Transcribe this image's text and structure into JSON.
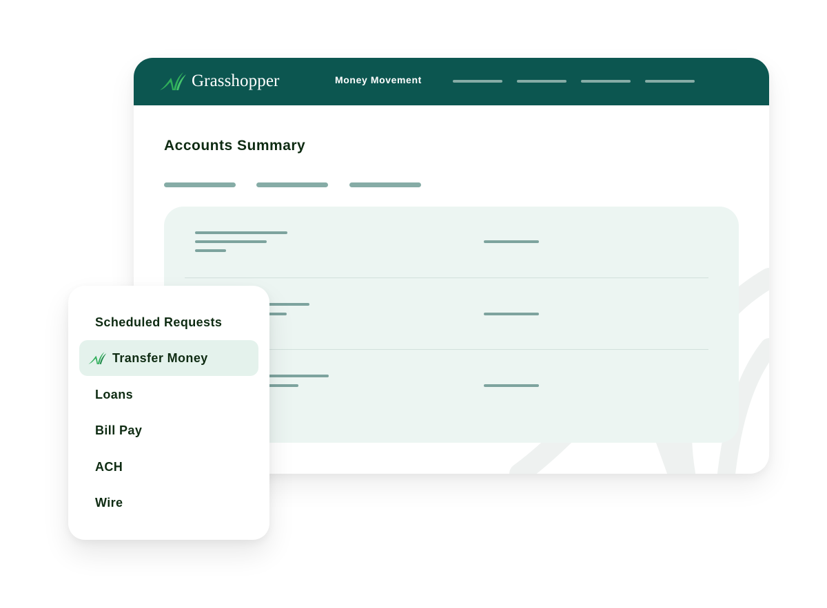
{
  "app": {
    "brand_name": "Grasshopper",
    "brand_icon": "grass-blades-icon",
    "colors": {
      "header_bg": "#0c5650",
      "accent_green": "#2fae5a",
      "text_dark": "#0e2b12",
      "placeholder": "#86aca6",
      "card_bg": "#ecf5f2",
      "active_item_bg": "#e4f2ec"
    }
  },
  "header": {
    "nav_items": [
      {
        "label": "Money Movement"
      }
    ],
    "nav_placeholder_count": 4
  },
  "main": {
    "title": "Accounts Summary",
    "tab_placeholder_count": 3,
    "account_rows": [
      {
        "left_lines": 3,
        "right_lines": 1
      },
      {
        "left_lines": 2,
        "right_lines": 1
      },
      {
        "left_lines": 2,
        "right_lines": 1
      }
    ]
  },
  "menu": {
    "items": [
      {
        "label": "Scheduled Requests",
        "active": false
      },
      {
        "label": "Transfer Money",
        "active": true,
        "icon": "grass-blades-icon"
      },
      {
        "label": "Loans",
        "active": false
      },
      {
        "label": "Bill Pay",
        "active": false
      },
      {
        "label": "ACH",
        "active": false
      },
      {
        "label": "Wire",
        "active": false
      }
    ]
  }
}
